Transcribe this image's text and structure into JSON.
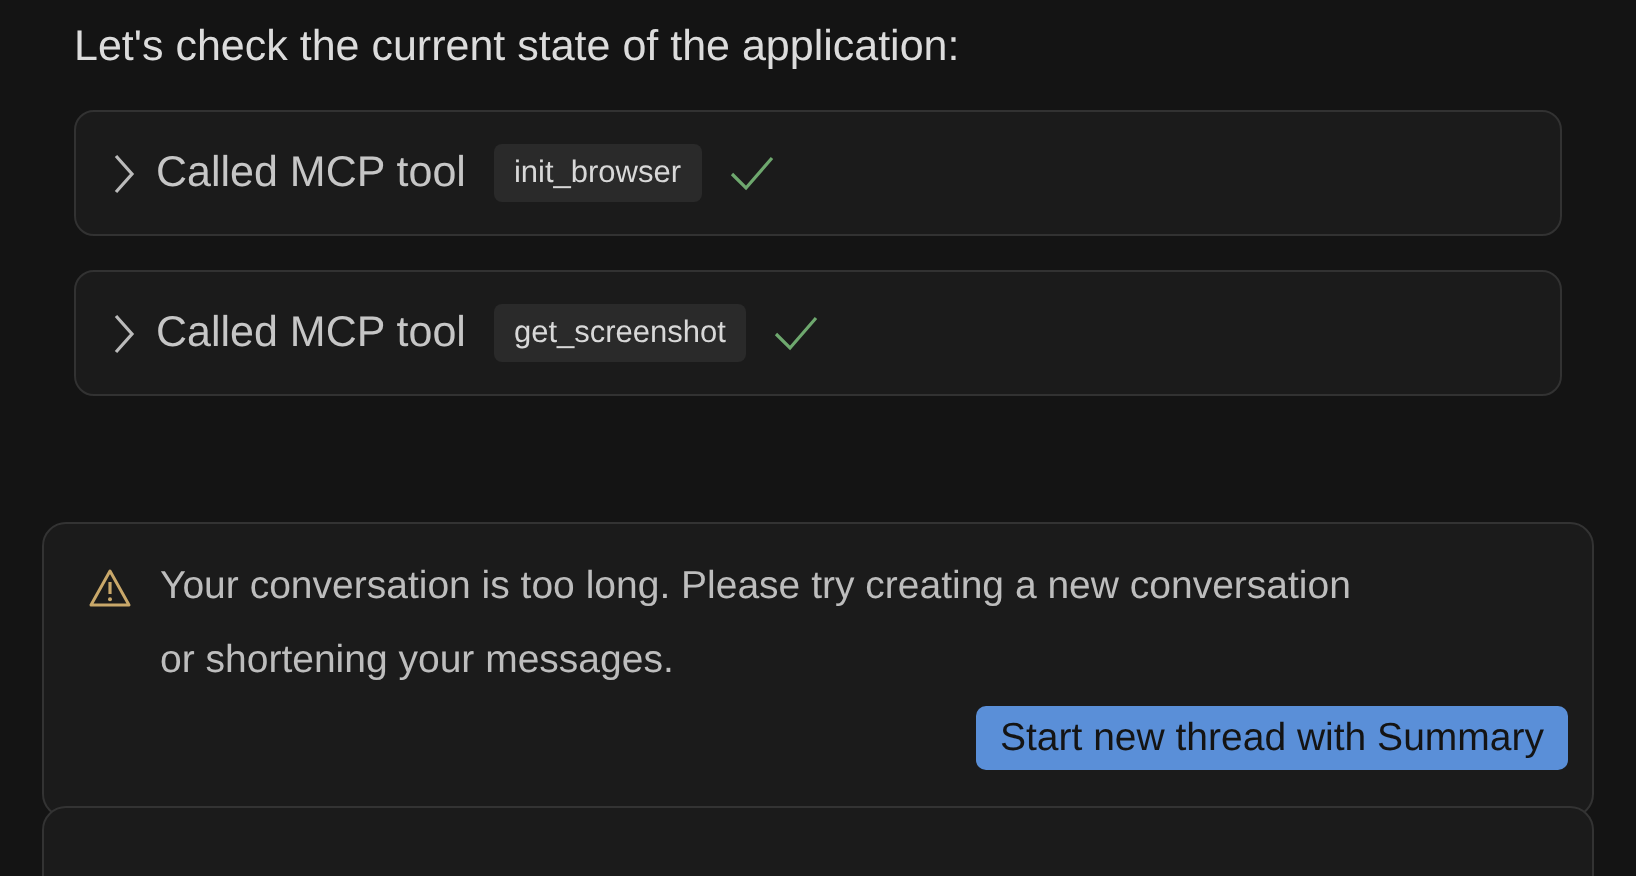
{
  "heading": "Let's check the current state of the application:",
  "tool_calls": [
    {
      "label": "Called MCP tool",
      "tool": "init_browser",
      "expanded": false,
      "succeeded": true
    },
    {
      "label": "Called MCP tool",
      "tool": "get_screenshot",
      "expanded": false,
      "succeeded": true
    }
  ],
  "alert": {
    "message": "Your conversation is too long. Please try creating a new conversation or shortening your messages.",
    "button": "Start new thread with Summary"
  }
}
